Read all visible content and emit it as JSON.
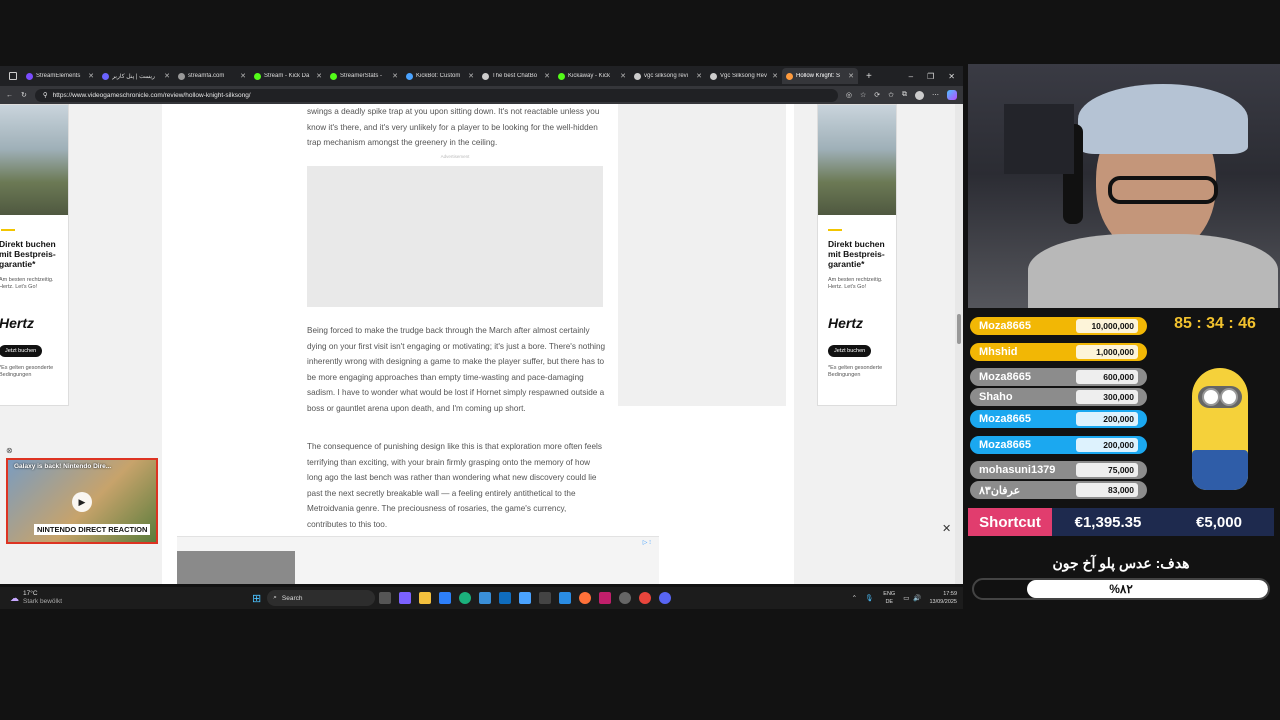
{
  "browser": {
    "tabs": [
      {
        "label": "StreamElements",
        "color": "#7a4cff"
      },
      {
        "label": "ریست | پنل کاربر",
        "color": "#6b63ff"
      },
      {
        "label": "streamfa.com",
        "color": "#999999"
      },
      {
        "label": "Stream - Kick Da",
        "color": "#53fc18"
      },
      {
        "label": "StreamerStats -",
        "color": "#53fc18"
      },
      {
        "label": "KickBot: Custom",
        "color": "#4aa3ff"
      },
      {
        "label": "The best ChatBo",
        "color": "#cccccc"
      },
      {
        "label": "Kickaway - Kick",
        "color": "#53fc18"
      },
      {
        "label": "vgc silksong revi",
        "color": "#cccccc"
      },
      {
        "label": "Vgc Silksong Rev",
        "color": "#cccccc"
      },
      {
        "label": "Hollow Knight: S",
        "color": "#ff9b3d",
        "active": true
      }
    ],
    "new_tab": "+",
    "url": "https://www.videogameschronicle.com/review/hollow-knight-silksong/"
  },
  "article": {
    "p1": "swings a deadly spike trap at you upon sitting down. It's not reactable unless you know it's there, and it's very unlikely for a player to be looking for the well-hidden trap mechanism amongst the greenery in the ceiling.",
    "ad_label": "Advertisement",
    "p2": "Being forced to make the trudge back through the March after almost certainly dying on your first visit isn't engaging or motivating; it's just a bore. There's nothing inherently wrong with designing a game to make the player suffer, but there has to be more engaging approaches than empty time-wasting and pace-damaging sadism. I have to wonder what would be lost if Hornet simply respawned outside a boss or gauntlet arena upon death, and I'm coming up short.",
    "p3": "The consequence of punishing design like this is that exploration more often feels terrifying than exciting, with your brain firmly grasping onto the memory of how long ago the last bench was rather than wondering what new discovery could lie past the next secretly breakable wall — a feeling entirely antithetical to the Metroidvania genre. The preciousness of rosaries, the game's currency, contributes to this too."
  },
  "side_ad": {
    "title": "Direkt buchen mit Bestpreis-garantie*",
    "sub": "Am besten rechtzeitig. Hertz. Let's Go!",
    "brand": "Hertz",
    "button": "Jetzt buchen",
    "fine": "*Es gelten gesonderte Bedingungen"
  },
  "video_popup": {
    "title": "Galaxy is back! Nintendo Dire...",
    "banner": "NINTENDO DIRECT REACTION"
  },
  "taskbar": {
    "weather_temp": "17°C",
    "weather_desc": "Stark bewölkt",
    "search": "Search",
    "lang1": "ENG",
    "lang2": "DE",
    "time": "17:59",
    "date": "13/09/2025"
  },
  "overlay": {
    "timer": "85 : 34 : 46",
    "donors": [
      {
        "name": "Moza8665",
        "amount": "10,000,000",
        "color": "#f2b705"
      },
      {
        "name": "Mhshid",
        "amount": "1,000,000",
        "color": "#f2b705"
      },
      {
        "name": "Moza8665",
        "amount": "600,000",
        "color": "#8c8c8c"
      },
      {
        "name": "Shaho",
        "amount": "300,000",
        "color": "#8c8c8c"
      },
      {
        "name": "Moza8665",
        "amount": "200,000",
        "color": "#1ba8f0"
      },
      {
        "name": "Moza8665",
        "amount": "200,000",
        "color": "#1ba8f0"
      },
      {
        "name": "mohasuni1379",
        "amount": "75,000",
        "color": "#8c8c8c"
      },
      {
        "name": "عرفان۸۳",
        "amount": "83,000",
        "color": "#8c8c8c"
      }
    ],
    "goal_label": "Shortcut",
    "goal_current": "€1,395.35",
    "goal_target": "€5,000",
    "goal2_title": "هدف: عدس پلو آخ جون",
    "goal2_percent": "%۸۲",
    "goal2_progress": 0.82
  }
}
